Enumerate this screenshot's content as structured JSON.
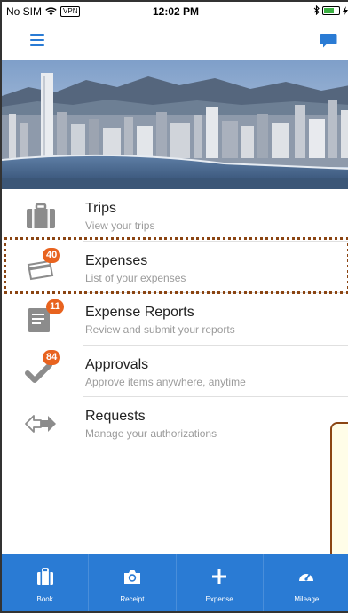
{
  "status_bar": {
    "carrier": "No SIM",
    "vpn": "VPN",
    "time": "12:02 PM",
    "battery_level": 0.7
  },
  "nav": {
    "menu_icon": "hamburger-icon",
    "chat_icon": "chat-bubble-icon"
  },
  "menu": {
    "items": [
      {
        "title": "Trips",
        "subtitle": "View your trips",
        "icon": "briefcase-icon",
        "badge": ""
      },
      {
        "title": "Expenses",
        "subtitle": "List of your expenses",
        "icon": "card-icon",
        "badge": "40"
      },
      {
        "title": "Expense Reports",
        "subtitle": "Review and submit your reports",
        "icon": "report-icon",
        "badge": "11"
      },
      {
        "title": "Approvals",
        "subtitle": "Approve items anywhere, anytime",
        "icon": "checkmark-icon",
        "badge": "84"
      },
      {
        "title": "Requests",
        "subtitle": "Manage your authorizations",
        "icon": "exchange-arrows-icon",
        "badge": ""
      }
    ]
  },
  "tabs": [
    {
      "label": "Book",
      "icon": "briefcase-icon"
    },
    {
      "label": "Receipt",
      "icon": "camera-icon"
    },
    {
      "label": "Expense",
      "icon": "plus-icon"
    },
    {
      "label": "Mileage",
      "icon": "speedometer-icon"
    }
  ],
  "colors": {
    "accent": "#2a7bd4",
    "badge": "#e8631f",
    "icon_gray": "#8c8c8c",
    "highlight": "#8b4513"
  }
}
